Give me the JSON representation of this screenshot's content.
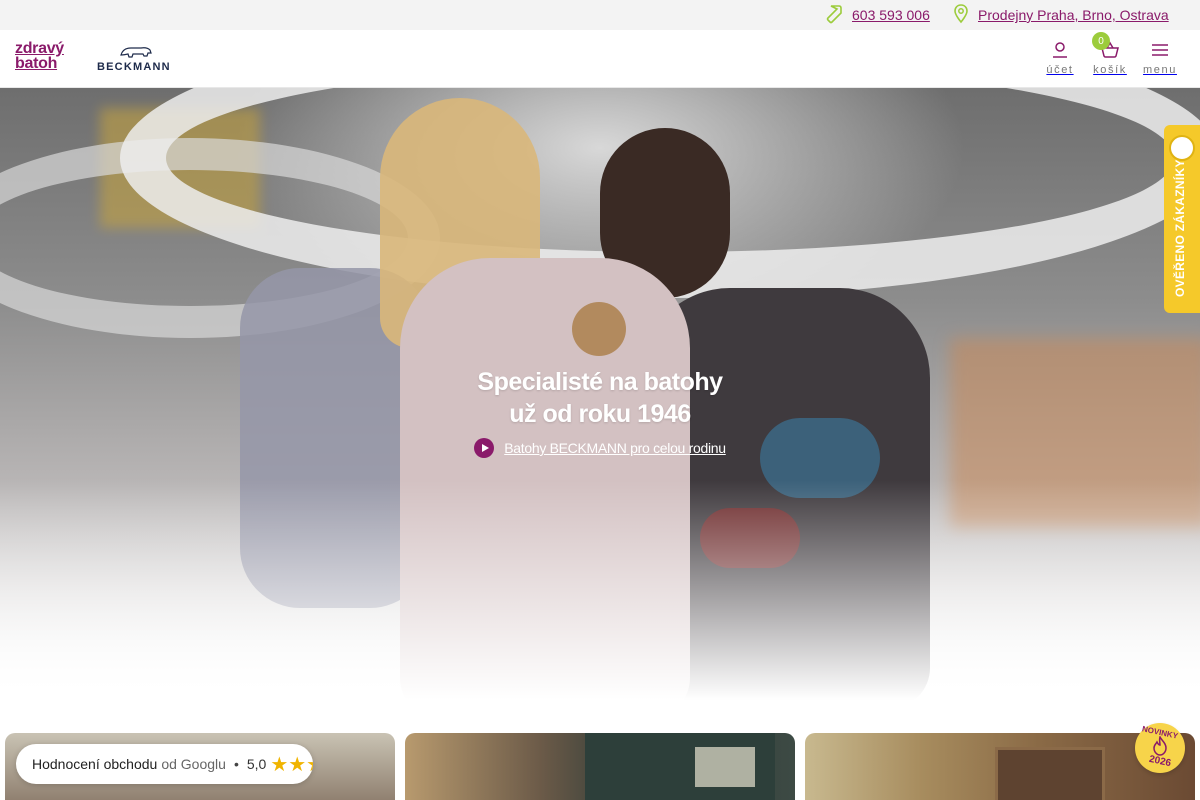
{
  "topbar": {
    "phone": "603 593 006",
    "stores": "Prodejny Praha, Brno, Ostrava"
  },
  "header": {
    "logo_main_line1": "zdravý",
    "logo_main_line2": "batoh",
    "logo_secondary": "BECKMANN",
    "account_label": "účet",
    "cart_label": "košík",
    "cart_count": "0",
    "menu_label": "menu"
  },
  "hero": {
    "title_line1": "Specialisté na batohy",
    "title_line2": "už od roku 1946",
    "link_text": "Batohy BECKMANN pro celou rodinu"
  },
  "side_badge": {
    "text": "OVĚŘENO ZÁKAZNÍKY"
  },
  "rating": {
    "label": "Hodnocení obchodu",
    "source": "od Googlu",
    "separator": "•",
    "score": "5,0",
    "stars": "★★★★★"
  },
  "new_badge": {
    "top": "NOVINKY",
    "year": "2026"
  },
  "colors": {
    "brand": "#8a1a6a",
    "accent": "#9ccc3c",
    "badge_yellow": "#f5c92a"
  }
}
